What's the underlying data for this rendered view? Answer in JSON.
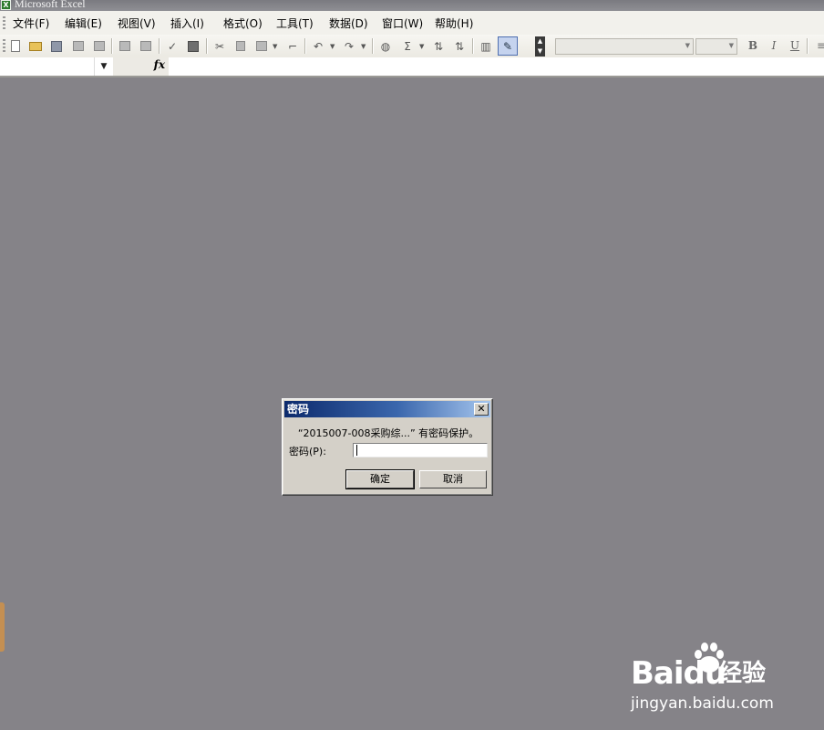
{
  "window": {
    "title": "Microsoft Excel"
  },
  "menu": [
    {
      "label": "文件(F)"
    },
    {
      "label": "编辑(E)"
    },
    {
      "label": "视图(V)"
    },
    {
      "label": "插入(I)"
    },
    {
      "label": "格式(O)"
    },
    {
      "label": "工具(T)"
    },
    {
      "label": "数据(D)"
    },
    {
      "label": "窗口(W)"
    },
    {
      "label": "帮助(H)"
    }
  ],
  "toolbar": {
    "icons": [
      "new-document-icon",
      "open-folder-icon",
      "save-icon",
      "permission-icon",
      "email-icon",
      "print-icon",
      "print-preview-icon",
      "spelling-icon",
      "research-icon",
      "cut-icon",
      "copy-icon",
      "paste-icon",
      "format-painter-icon",
      "undo-icon",
      "redo-icon",
      "hyperlink-icon",
      "autosum-icon",
      "sort-ascending-icon",
      "sort-descending-icon",
      "chart-wizard-icon",
      "drawing-icon"
    ],
    "format": {
      "bold": "B",
      "italic": "I",
      "underline": "U"
    },
    "font_name": "",
    "font_size": ""
  },
  "formula_bar": {
    "name_box": "",
    "fx": "fx",
    "formula": ""
  },
  "dialog": {
    "title": "密码",
    "message": "“2015007-008采购综...” 有密码保护。",
    "password_label": "密码(P):",
    "password_value": "",
    "ok_label": "确定",
    "cancel_label": "取消"
  },
  "watermark": {
    "brand": "Baidu",
    "suffix": "经验",
    "url": "jingyan.baidu.com"
  }
}
